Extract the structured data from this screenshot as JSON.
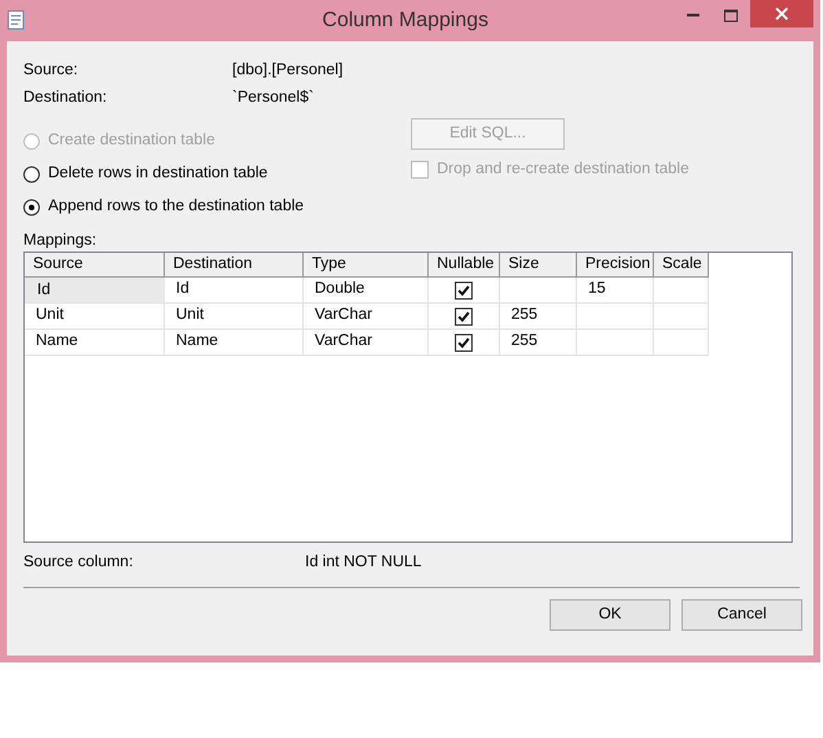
{
  "window": {
    "title": "Column Mappings"
  },
  "info": [
    {
      "label": "Source:",
      "value": "[dbo].[Personel]"
    },
    {
      "label": "Destination:",
      "value": "`Personel$`"
    }
  ],
  "options": [
    {
      "label": "Create destination table",
      "selected": false,
      "disabled": true
    },
    {
      "label": "Delete rows in destination table",
      "selected": false,
      "disabled": false
    },
    {
      "label": "Append rows to the destination table",
      "selected": true,
      "disabled": false
    }
  ],
  "edit_sql_button": {
    "label": "Edit SQL...",
    "disabled": true
  },
  "drop_checkbox": {
    "label": "Drop and re-create destination table",
    "checked": false,
    "disabled": true
  },
  "mappings": {
    "label": "Mappings:",
    "columns": [
      "Source",
      "Destination",
      "Type",
      "Nullable",
      "Size",
      "Precision",
      "Scale"
    ],
    "rows": [
      {
        "source": "Id",
        "destination": "Id",
        "type": "Double",
        "nullable": true,
        "precision": "15",
        "selected": true
      },
      {
        "source": "Unit",
        "destination": "Unit",
        "type": "VarChar",
        "nullable": true,
        "size": "255",
        "selected": false
      },
      {
        "source": "Name",
        "destination": "Name",
        "type": "VarChar",
        "nullable": true,
        "size": "255",
        "selected": false
      }
    ]
  },
  "source_column": {
    "label": "Source column:",
    "value": "Id int NOT NULL"
  },
  "buttons": [
    {
      "label": "OK"
    },
    {
      "label": "Cancel"
    }
  ]
}
